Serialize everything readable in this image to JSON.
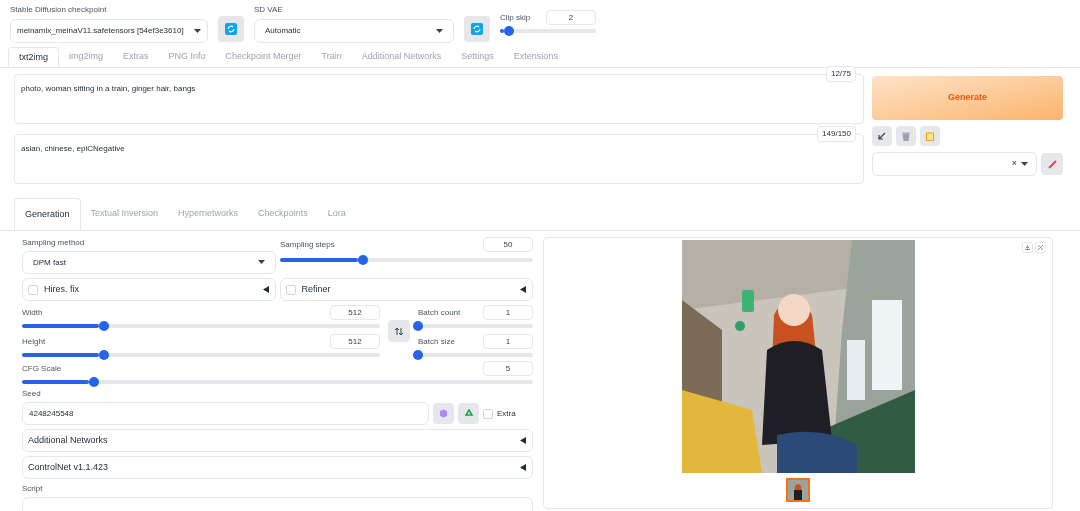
{
  "top_bar": {
    "checkpoint": {
      "label": "Stable Diffusion checkpoint",
      "value": "meinamix_meinaV11.safetensors [54ef3e3610]"
    },
    "vae": {
      "label": "SD VAE",
      "value": "Automatic"
    },
    "clip_skip": {
      "label": "Clip skip",
      "value": "2",
      "level": 0.09
    }
  },
  "tabs": [
    {
      "label": "txt2img",
      "selected": true
    },
    {
      "label": "img2img",
      "selected": false
    },
    {
      "label": "Extras",
      "selected": false
    },
    {
      "label": "PNG Info",
      "selected": false
    },
    {
      "label": "Checkpoint Merger",
      "selected": false
    },
    {
      "label": "Train",
      "selected": false
    },
    {
      "label": "Additional Networks",
      "selected": false
    },
    {
      "label": "Settings",
      "selected": false
    },
    {
      "label": "Extensions",
      "selected": false
    }
  ],
  "prompt": {
    "value": "photo, woman sitting in a train, ginger hair, bangs",
    "token_count": "12/75"
  },
  "negative_prompt": {
    "value": "asian, chinese,  epiCNegative",
    "token_count": "149/150"
  },
  "generate_button": "Generate",
  "style_select": {
    "clear": "×"
  },
  "sub_tabs": [
    {
      "label": "Generation",
      "selected": true
    },
    {
      "label": "Textual Inversion",
      "selected": false
    },
    {
      "label": "Hypernetworks",
      "selected": false
    },
    {
      "label": "Checkpoints",
      "selected": false
    },
    {
      "label": "Lora",
      "selected": false
    }
  ],
  "sampling_method": {
    "label": "Sampling method",
    "value": "DPM fast"
  },
  "sampling_steps": {
    "label": "Sampling steps",
    "value": "50",
    "level": 0.33
  },
  "hires_fix": {
    "label": "Hires. fix",
    "checked": false,
    "expanded": false
  },
  "refiner": {
    "label": "Refiner",
    "checked": false,
    "expanded": false
  },
  "size_sliders": [
    {
      "label": "Width",
      "value": "512",
      "level": 0.23
    },
    {
      "label": "Height",
      "value": "512",
      "level": 0.23
    }
  ],
  "batch_sliders": [
    {
      "label": "Batch count",
      "value": "1",
      "level": 0
    },
    {
      "label": "Batch size",
      "value": "1",
      "level": 0
    }
  ],
  "cfg_scale": {
    "label": "CFG Scale",
    "value": "5",
    "level": 0.14
  },
  "seed": {
    "label": "Seed",
    "value": "4248245548",
    "extra": {
      "label": "Extra",
      "checked": false
    }
  },
  "accordions": [
    {
      "label": "Additional Networks",
      "expanded": false
    },
    {
      "label": "ControlNet v1.1.423",
      "expanded": false
    }
  ],
  "script": {
    "label": "Script"
  },
  "gallery": {
    "thumbnails": [
      {
        "selected": true
      }
    ]
  }
}
